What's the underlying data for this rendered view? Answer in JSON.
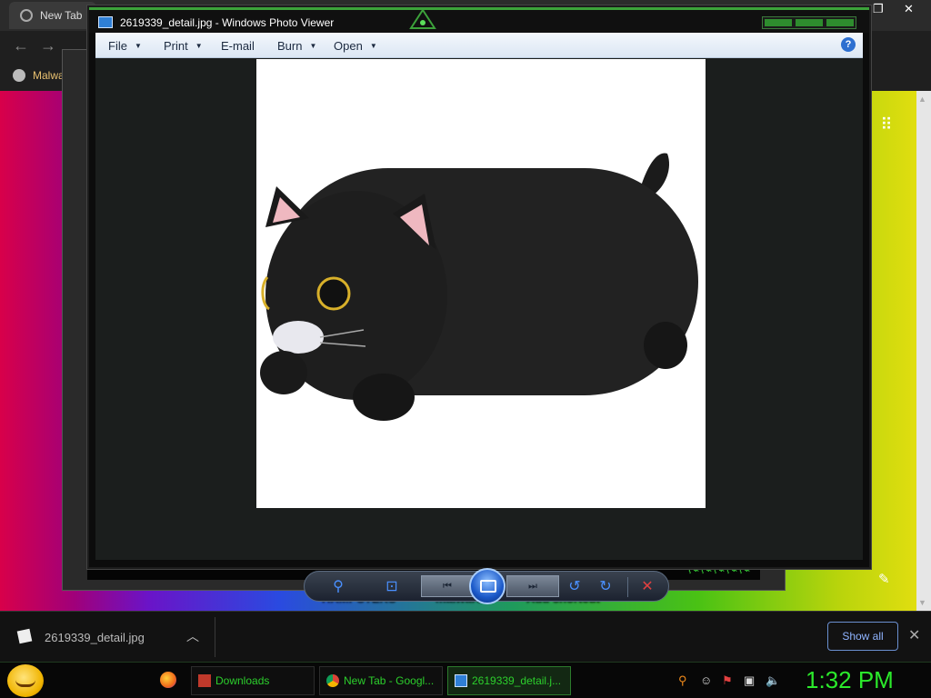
{
  "chrome": {
    "tab_title": "New Tab",
    "bookmark": "Malwa",
    "shortcuts": [
      "HAMPSTERS",
      "malware",
      "Add shortcut"
    ]
  },
  "viewer": {
    "title": "2619339_detail.jpg - Windows Photo Viewer",
    "menu": [
      {
        "label": "File",
        "has_dropdown": true
      },
      {
        "label": "Print",
        "has_dropdown": true
      },
      {
        "label": "E-mail",
        "has_dropdown": false
      },
      {
        "label": "Burn",
        "has_dropdown": true
      },
      {
        "label": "Open",
        "has_dropdown": true
      }
    ],
    "help_glyph": "?",
    "photo_subject": "black cat plush pillow",
    "controls": [
      "zoom-icon",
      "actual-size-icon",
      "previous-icon",
      "slideshow-icon",
      "next-icon",
      "rotate-ccw-icon",
      "rotate-cw-icon",
      "delete-icon"
    ]
  },
  "downloads": {
    "file_name": "2619339_detail.jpg",
    "show_all": "Show all"
  },
  "taskbar": {
    "items": [
      {
        "label": "Downloads",
        "icon": "folder-icon",
        "active": false
      },
      {
        "label": "New Tab - Googl...",
        "icon": "chrome-icon",
        "active": false
      },
      {
        "label": "2619339_detail.j...",
        "icon": "photo-viewer-icon",
        "active": true
      }
    ],
    "clock": "1:32 PM"
  },
  "colors": {
    "taskbar_text": "#2ccf2c",
    "clock": "#2bea2b",
    "accent_blue": "#4a90ff"
  }
}
